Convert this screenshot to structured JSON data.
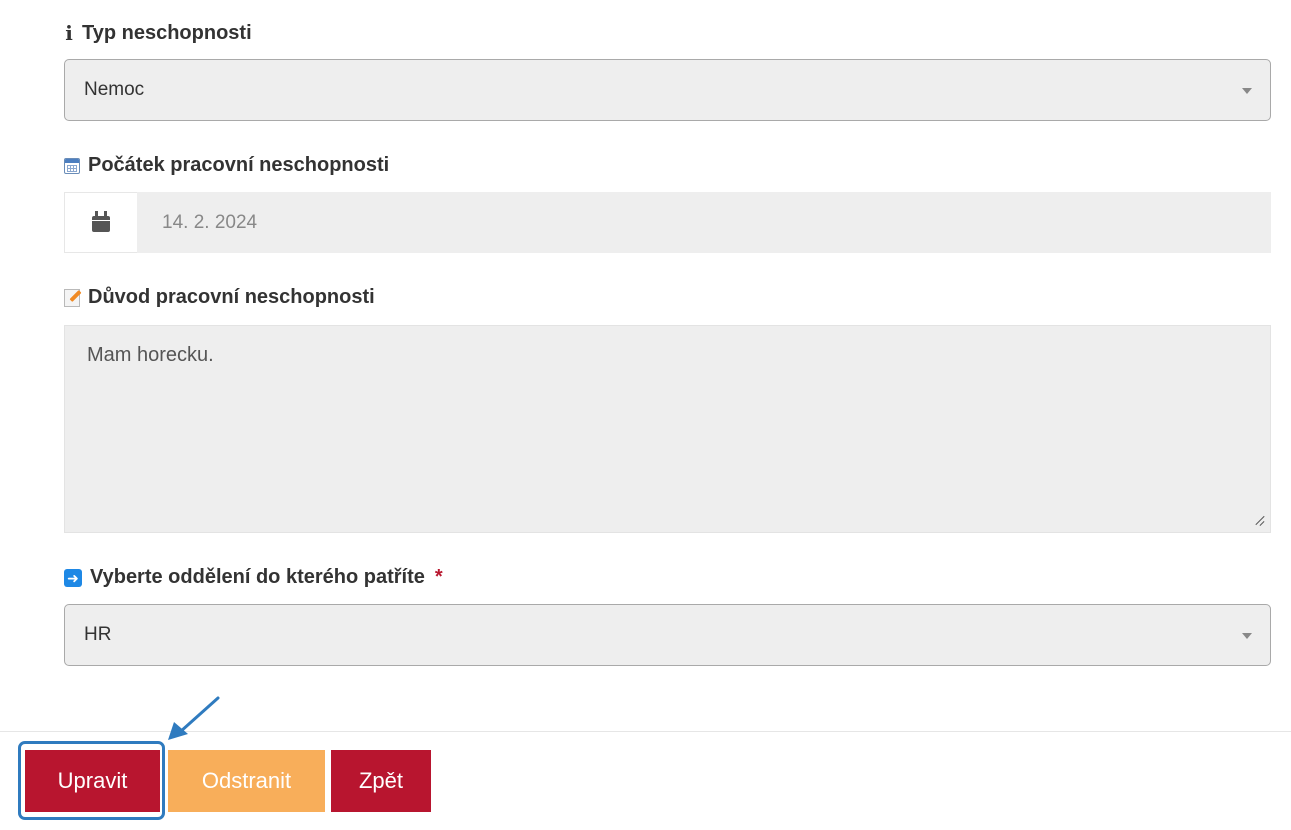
{
  "fields": {
    "type": {
      "label": "Typ neschopnosti",
      "icon": "info-icon",
      "value": "Nemoc"
    },
    "start_date": {
      "label": "Počátek pracovní neschopnosti",
      "icon": "calendar-icon",
      "value": "14. 2. 2024",
      "addon_icon": "calendar-solid-icon"
    },
    "reason": {
      "label": "Důvod pracovní neschopnosti",
      "icon": "edit-icon",
      "value": "Mam horecku."
    },
    "department": {
      "label": "Vyberte oddělení do kterého patříte",
      "required_mark": "*",
      "icon": "arrow-right-icon",
      "value": "HR"
    }
  },
  "actions": {
    "edit_label": "Upravit",
    "delete_label": "Odstranit",
    "back_label": "Zpět"
  },
  "colors": {
    "primary": "#b8152f",
    "warning": "#f8ae5a",
    "highlight": "#2f7bbf",
    "field_background": "#eeeeee"
  }
}
